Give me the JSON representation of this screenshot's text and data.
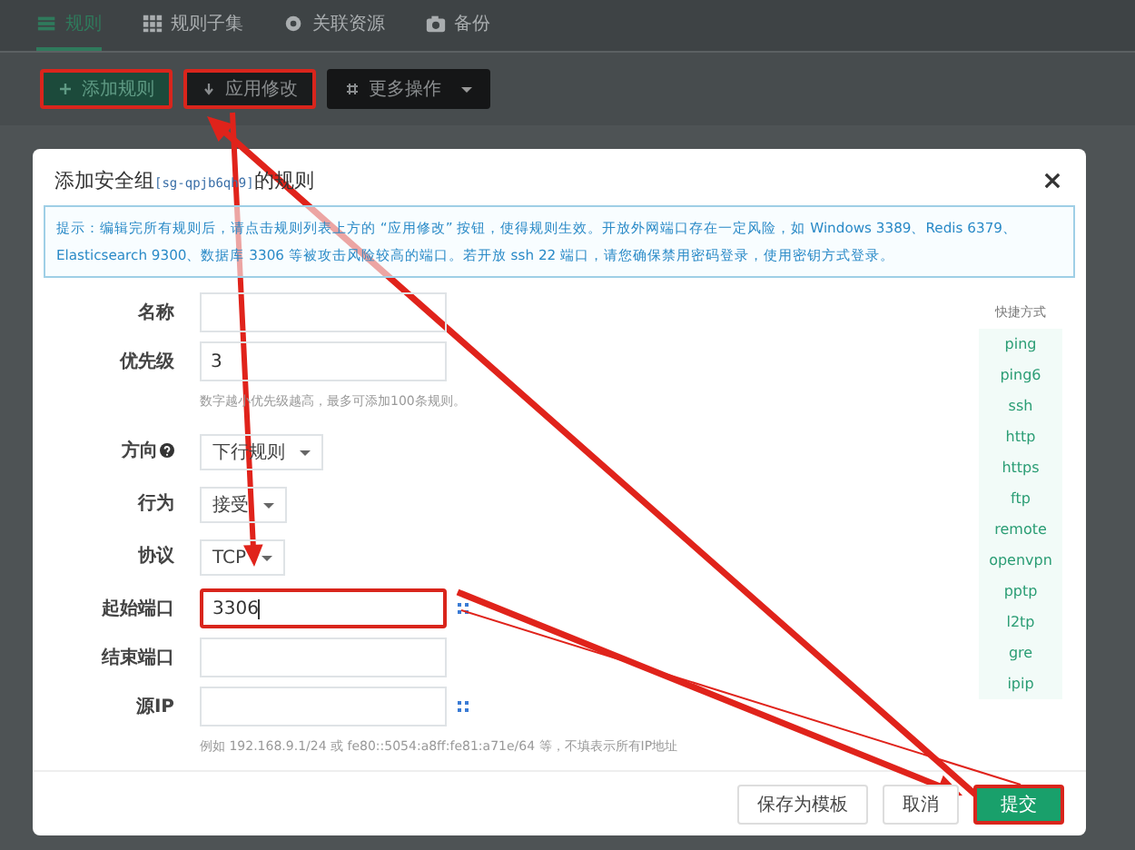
{
  "tabs": [
    {
      "label": "规则",
      "selected": true
    },
    {
      "label": "规则子集",
      "selected": false
    },
    {
      "label": "关联资源",
      "selected": false
    },
    {
      "label": "备份",
      "selected": false
    }
  ],
  "toolbar": [
    {
      "label": "添加规则",
      "kind": "primary",
      "highlighted": true
    },
    {
      "label": "应用修改",
      "kind": "dark",
      "highlighted": true
    },
    {
      "label": "更多操作",
      "kind": "dropdown",
      "highlighted": false
    }
  ],
  "dialog": {
    "title_parts": [
      {
        "text": "添加安全组",
        "kind": "plain"
      },
      {
        "text": "[sg-qpjb6qh9]",
        "kind": "code"
      },
      {
        "text": "的规则",
        "kind": "plain"
      }
    ],
    "notice": "提示：编辑完所有规则后，请点击规则列表上方的 “应用修改” 按钮，使得规则生效。开放外网端口存在一定风险，如 Windows 3389、Redis 6379、Elasticsearch 9300、数据库 3306 等被攻击风险较高的端口。若开放 ssh 22 端口，请您确保禁用密码登录，使用密钥方式登录。",
    "fields": [
      {
        "label": "名称",
        "kind": "text",
        "highlighted": false,
        "handle": false
      },
      {
        "label": "优先级",
        "kind": "text",
        "value": "3",
        "hint": "数字越小优先级越高，最多可添加100条规则。",
        "highlighted": false,
        "handle": false
      },
      {
        "label": "方向",
        "kind": "select",
        "value": "下行规则",
        "help": true,
        "highlighted": false,
        "handle": false
      },
      {
        "label": "行为",
        "kind": "select",
        "value": "接受",
        "highlighted": false,
        "handle": false
      },
      {
        "label": "协议",
        "kind": "select",
        "value": "TCP",
        "highlighted": false,
        "handle": false
      },
      {
        "label": "起始端口",
        "kind": "text",
        "value": "3306",
        "highlighted": true,
        "handle": true
      },
      {
        "label": "结束端口",
        "kind": "text",
        "highlighted": false,
        "handle": false
      },
      {
        "label": "源IP",
        "kind": "text",
        "hint": "例如 192.168.9.1/24 或 fe80::5054:a8ff:fe81:a71e/64 等，不填表示所有IP地址",
        "highlighted": false,
        "handle": true
      }
    ],
    "shortcuts": {
      "title": "快捷方式",
      "items": [
        "ping",
        "ping6",
        "ssh",
        "http",
        "https",
        "ftp",
        "remote",
        "openvpn",
        "pptp",
        "l2tp",
        "gre",
        "ipip"
      ]
    },
    "buttons": [
      {
        "label": "保存为模板",
        "kind": "default",
        "highlighted": false
      },
      {
        "label": "取消",
        "kind": "default",
        "highlighted": false
      },
      {
        "label": "提交",
        "kind": "primary",
        "highlighted": true
      }
    ]
  }
}
